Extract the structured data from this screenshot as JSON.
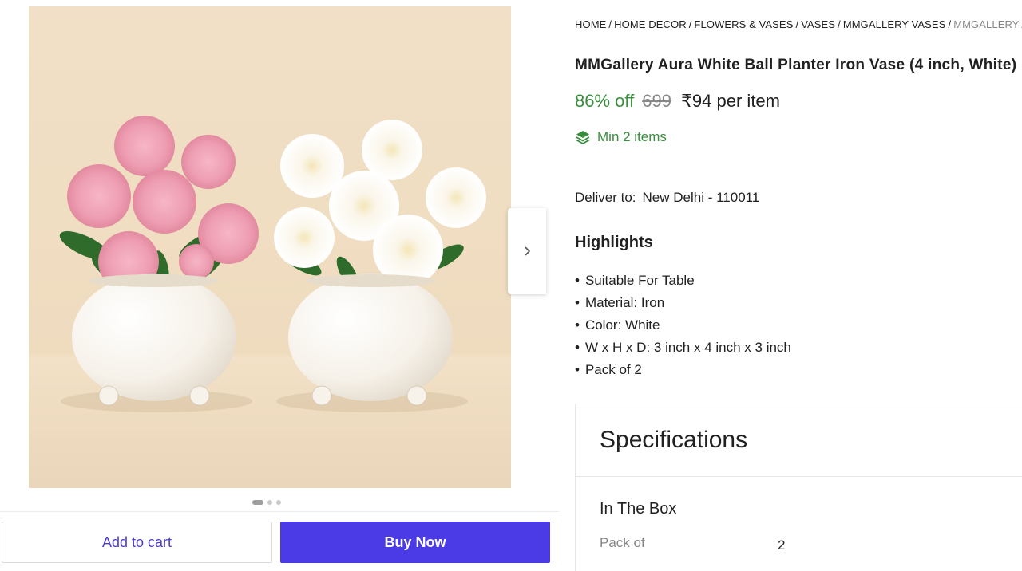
{
  "breadcrumb": [
    "HOME",
    "HOME DECOR",
    "FLOWERS & VASES",
    "VASES",
    "MMGALLERY VASES",
    "MMGALLERY AURA"
  ],
  "product": {
    "title": "MMGallery Aura White Ball Planter Iron Vase (4 inch, White)",
    "discount": "86% off",
    "mrp": "699",
    "price": "₹94 per item",
    "min_items": "Min 2 items"
  },
  "delivery": {
    "label": "Deliver to:",
    "location": "New Delhi - 110011"
  },
  "highlights": {
    "heading": "Highlights",
    "items": [
      "Suitable For Table",
      "Material: Iron",
      "Color: White",
      "W x H x D: 3 inch x 4 inch x 3 inch",
      "Pack of 2"
    ]
  },
  "specifications": {
    "title": "Specifications",
    "group": "In The Box",
    "rows": [
      {
        "key": "Pack of",
        "value": "2"
      }
    ]
  },
  "actions": {
    "add_to_cart": "Add to cart",
    "buy_now": "Buy Now"
  },
  "gallery": {
    "image_count": 3,
    "active_index": 0
  },
  "icons": {
    "next": "chevron-right-icon",
    "min_items": "stack-layers-icon"
  },
  "colors": {
    "discount": "#388e3c",
    "buy_button": "#4b3be6",
    "cart_text": "#4a3cc9",
    "image_background": "#efdcc2"
  }
}
